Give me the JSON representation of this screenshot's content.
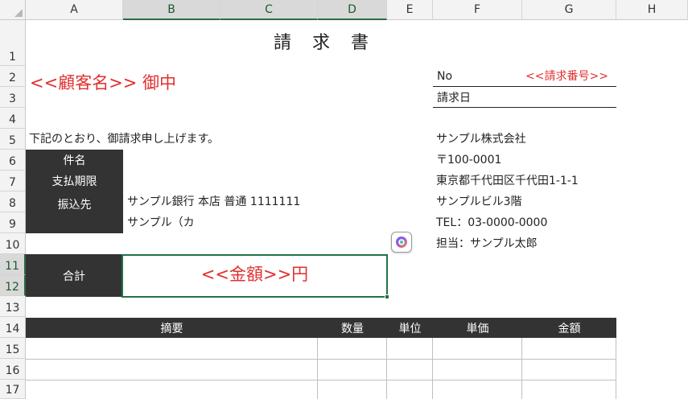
{
  "columns": [
    "A",
    "B",
    "C",
    "D",
    "E",
    "F",
    "G",
    "H"
  ],
  "rows": [
    "1",
    "2",
    "3",
    "4",
    "5",
    "6",
    "7",
    "8",
    "9",
    "10",
    "11",
    "12",
    "13",
    "14",
    "15",
    "16",
    "17"
  ],
  "invoice": {
    "title": "請　求　書",
    "customer": "<<顧客名>> 御中",
    "no_label": "No",
    "no_value": "<<請求番号>>",
    "date_label": "請求日",
    "intro": "下記のとおり、御請求申し上げます。",
    "labels": {
      "subject": "件名",
      "due": "支払期限",
      "bank": "振込先",
      "total": "合計"
    },
    "bank_line1": "サンプル銀行 本店 普通 1111111",
    "bank_line2": "サンプル（カ",
    "total_amount": "<<金額>>円",
    "company": {
      "name": "サンプル株式会社",
      "postal": "〒100-0001",
      "address": "東京都千代田区千代田1-1-1",
      "building": "サンプルビル3階",
      "tel": "TEL：03-0000-0000",
      "contact": "担当：サンプル太郎"
    },
    "table_headers": {
      "description": "摘要",
      "quantity": "数量",
      "unit": "単位",
      "unit_price": "単価",
      "amount": "金額"
    }
  },
  "colors": {
    "red": "#e03030",
    "dark": "#333333",
    "selection": "#217346"
  },
  "floating_icon": "copilot-icon"
}
